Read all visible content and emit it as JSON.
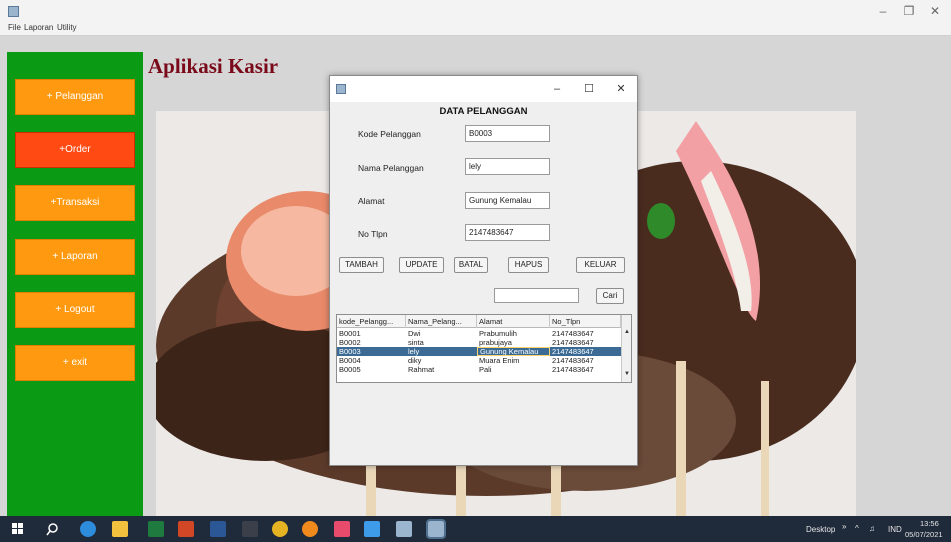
{
  "menu": {
    "items": [
      "File",
      "Laporan",
      "Utility"
    ]
  },
  "app_title": "Aplikasi Kasir",
  "sidebar": {
    "buttons": [
      "+ Pelanggan",
      "+Order",
      "+Transaksi",
      "+ Laporan",
      "+ Logout",
      "+ exit"
    ]
  },
  "dialog": {
    "heading": "DATA PELANGGAN",
    "fields": [
      {
        "label": "Kode Pelanggan",
        "value": "B0003"
      },
      {
        "label": "Nama Pelanggan",
        "value": "lely"
      },
      {
        "label": "Alamat",
        "value": "Gunung Kemalau"
      },
      {
        "label": "No Tlpn",
        "value": "2147483647"
      }
    ],
    "buttons": [
      "TAMBAH",
      "UPDATE",
      "BATAL",
      "HAPUS",
      "KELUAR"
    ],
    "search": {
      "value": "",
      "button": "Cari"
    },
    "table": {
      "columns": [
        "kode_Pelangg...",
        "Nama_Pelang...",
        "Alamat",
        "No_Tlpn"
      ],
      "rows": [
        [
          "B0001",
          "Dwi",
          "Prabumulih",
          "2147483647"
        ],
        [
          "B0002",
          "sinta",
          "prabujaya",
          "2147483647"
        ],
        [
          "B0003",
          "lely",
          "Gunung Kemalau",
          "2147483647"
        ],
        [
          "B0004",
          "diky",
          "Muara Enim",
          "2147483647"
        ],
        [
          "B0005",
          "Rahmat",
          "Pali",
          "2147483647"
        ]
      ],
      "selected_row": 2
    }
  },
  "taskbar": {
    "desktop_label": "Desktop",
    "language": "IND",
    "time": "13:56",
    "date": "05/07/2021"
  }
}
